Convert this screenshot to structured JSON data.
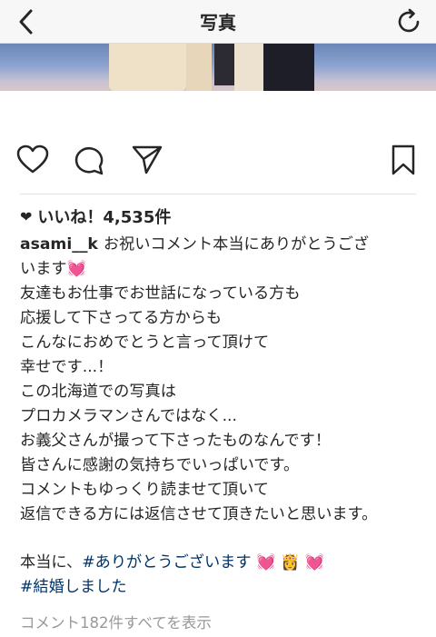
{
  "header": {
    "title": "写真",
    "back_icon": "chevron-left-icon",
    "refresh_icon": "refresh-icon"
  },
  "actions": {
    "like_icon": "heart-outline-icon",
    "comment_icon": "comment-bubble-icon",
    "share_icon": "paper-plane-icon",
    "save_icon": "bookmark-icon"
  },
  "likes": {
    "text": "いいね！4,535件"
  },
  "caption": {
    "username": "asami__k",
    "line1": "お祝いコメント本当にありがとうござ",
    "line2": "います",
    "line2_emoji": "💓",
    "body": "友達もお仕事でお世話になっている方も\n応援して下さってる方からも\nこんなにおめでとうと言って頂けて\n幸せです...！\nこの北海道での写真は\nプロカメラマンさんではなく...\nお義父さんが撮って下さったものなんです！\n皆さんに感謝の気持ちでいっぱいです。\nコメントもゆっくり読ませて頂いて\n返信できる方には返信させて頂きたいと思います。"
  },
  "hashtags": {
    "prefix": "本当に、",
    "tag1": "#ありがとうございます",
    "emojis": "💓 👸 💓",
    "tag2": "#結婚しました"
  },
  "comments": {
    "view_all": "コメント182件すべてを表示"
  },
  "colors": {
    "hashtag": "#003569",
    "muted": "#999999",
    "text": "#262626"
  }
}
